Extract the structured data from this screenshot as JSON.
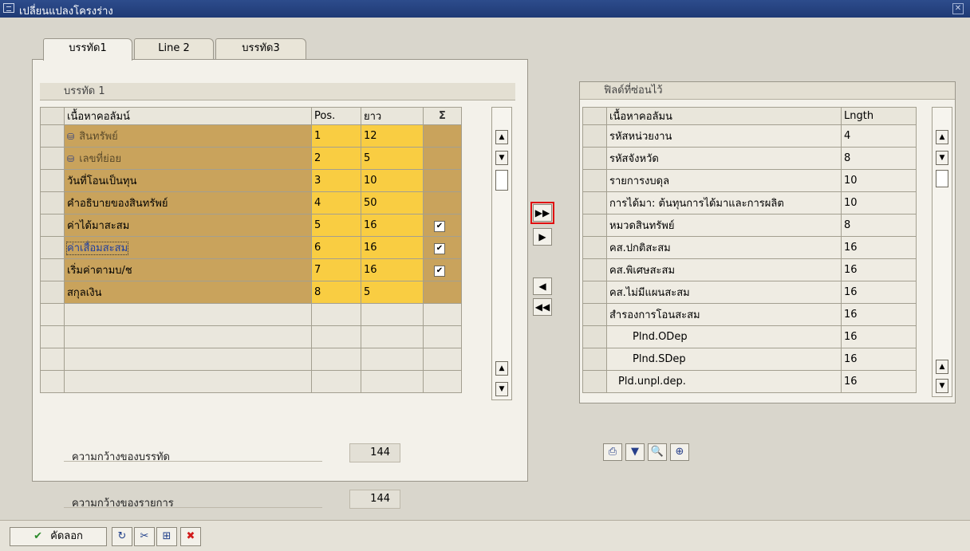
{
  "window": {
    "title": "เปลี่ยนแปลงโครงร่าง"
  },
  "tabs": [
    {
      "label": "บรรทัด1",
      "active": true
    },
    {
      "label": "Line 2",
      "active": false
    },
    {
      "label": "บรรทัด3",
      "active": false
    }
  ],
  "left": {
    "group_title": "บรรทัด 1",
    "headers": {
      "content": "เนื้อหาคอลัมน์",
      "pos": "Pos.",
      "len": "ยาว",
      "sum": "Σ"
    },
    "rows": [
      {
        "label": "สินทรัพย์",
        "pos": "1",
        "len": "12",
        "check": "",
        "icon": "⛁"
      },
      {
        "label": "เลขที่ย่อย",
        "pos": "2",
        "len": "5",
        "check": "",
        "icon": "⛁"
      },
      {
        "label": "วันที่โอนเป็นทุน",
        "pos": "3",
        "len": "10",
        "check": ""
      },
      {
        "label": "คำอธิบายของสินทรัพย์",
        "pos": "4",
        "len": "50",
        "check": ""
      },
      {
        "label": "ค่าได้มาสะสม",
        "pos": "5",
        "len": "16",
        "check": "✔"
      },
      {
        "label": "ค่าเสื่อมสะสม",
        "pos": "6",
        "len": "16",
        "check": "✔"
      },
      {
        "label": "เริ่มค่าตามบ/ช",
        "pos": "7",
        "len": "16",
        "check": "✔"
      },
      {
        "label": "สกุลเงิน",
        "pos": "8",
        "len": "5",
        "check": ""
      }
    ],
    "line_width_label": "ความกว้างของบรรทัด",
    "line_width_value": "144",
    "list_width_label": "ความกว้างของรายการ",
    "list_width_value": "144"
  },
  "right": {
    "group_title": "ฟิลด์ที่ซ่อนไว้",
    "headers": {
      "content": "เนื้อหาคอลัมน",
      "len": "Lngth"
    },
    "rows": [
      {
        "label": "รหัสหน่วยงาน",
        "len": "4"
      },
      {
        "label": "รหัสจังหวัด",
        "len": "8"
      },
      {
        "label": "รายการงบดุล",
        "len": "10"
      },
      {
        "label": "การได้มา: ต้นทุนการได้มาและการผลิต",
        "len": "10"
      },
      {
        "label": "หมวดสินทรัพย์",
        "len": "8"
      },
      {
        "label": "คส.ปกติสะสม",
        "len": "16"
      },
      {
        "label": "คส.พิเศษสะสม",
        "len": "16"
      },
      {
        "label": "คส.ไม่มีแผนสะสม",
        "len": "16"
      },
      {
        "label": "สำรองการโอนสะสม",
        "len": "16"
      },
      {
        "label": "Plnd.ODep",
        "len": "16"
      },
      {
        "label": "Plnd.SDep",
        "len": "16"
      },
      {
        "label": "Pld.unpl.dep.",
        "len": "16"
      }
    ]
  },
  "nav": {
    "all_right": "▶▶",
    "right": "▶",
    "left": "◀",
    "all_left": "◀◀"
  },
  "tools": {
    "print": "⎙",
    "filter": "▼",
    "find": "🔍",
    "find_next": "⊕"
  },
  "bottom": {
    "copy_label": "คัดลอก",
    "copy_icon": "✔",
    "refresh_icon": "↻",
    "cut_icon": "✂",
    "hierarchy_icon": "⊞",
    "cancel_icon": "✖"
  },
  "colors": {
    "title_bar": "#2d4c8c",
    "key_cell": "#c9a35c",
    "value_cell": "#f9cd42",
    "highlight": "#e01010"
  }
}
